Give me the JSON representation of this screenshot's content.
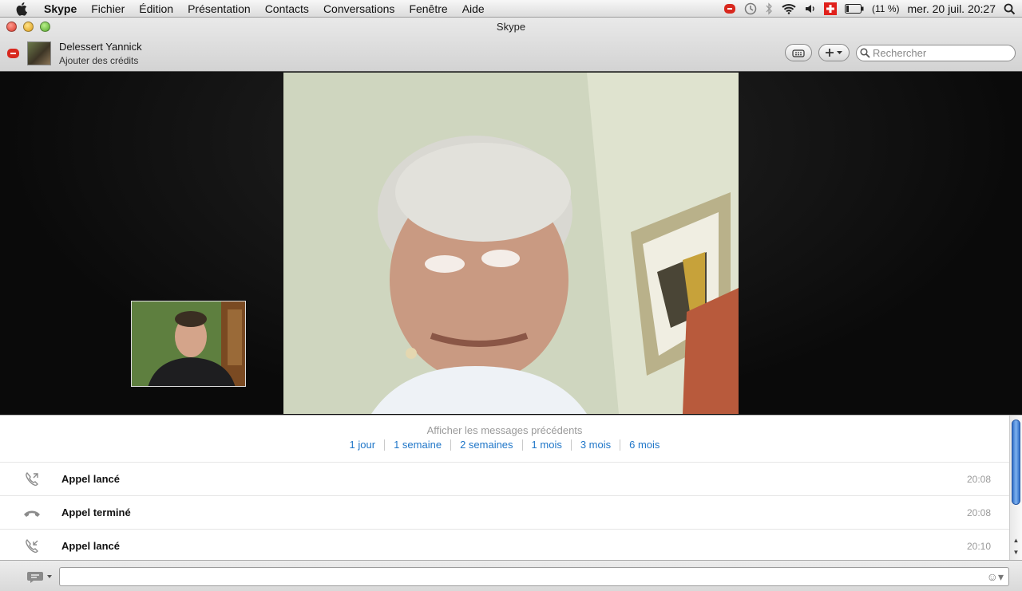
{
  "menubar": {
    "app": "Skype",
    "items": [
      "Fichier",
      "Édition",
      "Présentation",
      "Contacts",
      "Conversations",
      "Fenêtre",
      "Aide"
    ],
    "battery": "(11 %)",
    "datetime": "mer. 20 juil.  20:27"
  },
  "window": {
    "title": "Skype",
    "user_name": "Delessert Yannick",
    "user_credits": "Ajouter des crédits",
    "search_placeholder": "Rechercher"
  },
  "history": {
    "title": "Afficher les messages précédents",
    "links": [
      "1 jour",
      "1 semaine",
      "2 semaines",
      "1 mois",
      "3 mois",
      "6 mois"
    ]
  },
  "events": [
    {
      "icon": "call-outgoing-icon",
      "text": "Appel lancé",
      "time": "20:08"
    },
    {
      "icon": "call-ended-icon",
      "text": "Appel terminé",
      "time": "20:08"
    },
    {
      "icon": "call-incoming-icon",
      "text": "Appel lancé",
      "time": "20:10"
    }
  ],
  "colors": {
    "link": "#1f76c8",
    "status_red": "#d8281e",
    "scroll_blue": "#2f6ec9"
  }
}
